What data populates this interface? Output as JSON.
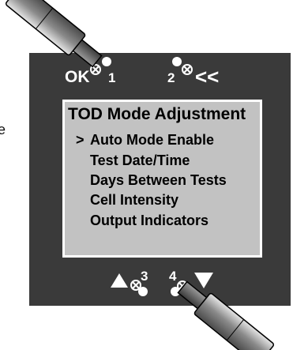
{
  "stray_char": "e",
  "screen": {
    "title": "TOD Mode Adjustment",
    "cursor": ">",
    "items": [
      "Auto Mode Enable",
      "Test Date/Time",
      "Days Between Tests",
      "Cell Intensity",
      "Output Indicators"
    ]
  },
  "buttons": {
    "b1": {
      "text": "OK",
      "number": "1"
    },
    "b2": {
      "number": "2",
      "arrow": "<<"
    },
    "b3": {
      "number": "3",
      "icon": "up-triangle-icon"
    },
    "b4": {
      "number": "4",
      "icon": "down-triangle-icon"
    }
  },
  "colors": {
    "panel": "#3a3a3a",
    "screen": "#c2c2c2",
    "text_on_panel": "#ffffff"
  }
}
